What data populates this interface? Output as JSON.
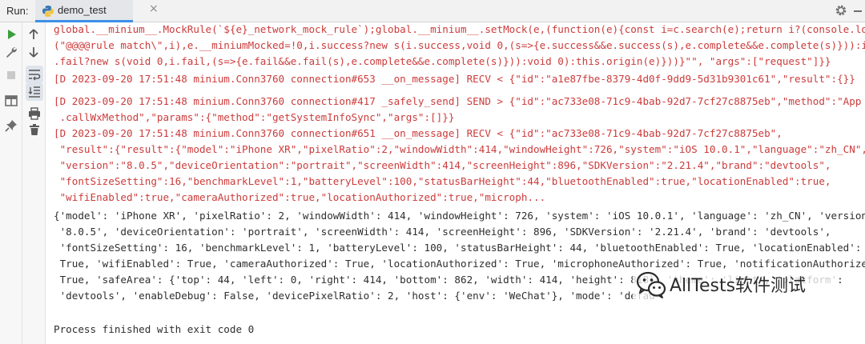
{
  "header": {
    "run_label": "Run:",
    "tab_label": "demo_test",
    "tab_close": "×"
  },
  "toolbar_left": [
    {
      "name": "run-icon"
    },
    {
      "name": "wrench-icon"
    },
    {
      "name": "stop-icon"
    },
    {
      "name": "layout-icon"
    },
    {
      "name": "pin-icon"
    }
  ],
  "toolbar_right": [
    {
      "name": "arrow-up-icon"
    },
    {
      "name": "arrow-down-icon"
    },
    {
      "name": "soft-wrap-icon"
    },
    {
      "name": "scroll-to-end-icon"
    },
    {
      "name": "print-icon"
    },
    {
      "name": "trash-icon"
    }
  ],
  "console": {
    "lines": [
      {
        "color": "red",
        "text": "global.__minium__.MockRule(`${e}_network_mock_rule`);global.__minium__.setMock(e,(function(e){const i=c.search(e);return i?(console.log"
      },
      {
        "color": "red",
        "text": "(\"@@@@rule match\\\",i),e.__miniumMocked=!0,i.success?new s(i.success,void 0,(s=>{e.success&&e.success(s),e.complete&&e.complete(s)})):i"
      },
      {
        "color": "red",
        "text": ".fail?new s(void 0,i.fail,(s=>{e.fail&&e.fail(s),e.complete&&e.complete(s)})):void 0):this.origin(e)}))}\"\", \"args\":[\"request\"]}}"
      },
      {
        "color": "red",
        "text": "[D 2023-09-20 17:51:48 minium.Conn3760 connection#653 __on_message] RECV < {\"id\":\"a1e87fbe-8379-4d0f-9dd9-5d31b9301c61\",\"result\":{}}"
      },
      {
        "color": "red",
        "text": "[D 2023-09-20 17:51:48 minium.Conn3760 connection#417 _safely_send] SEND > {\"id\":\"ac733e08-71c9-4bab-92d7-7cf27c8875eb\",\"method\":\"App"
      },
      {
        "color": "red",
        "text": " .callWxMethod\",\"params\":{\"method\":\"getSystemInfoSync\",\"args\":[]}}"
      },
      {
        "color": "red",
        "text": "[D 2023-09-20 17:51:48 minium.Conn3760 connection#651 __on_message] RECV < {\"id\":\"ac733e08-71c9-4bab-92d7-7cf27c8875eb\","
      },
      {
        "color": "red",
        "text": " \"result\":{\"result\":{\"model\":\"iPhone XR\",\"pixelRatio\":2,\"windowWidth\":414,\"windowHeight\":726,\"system\":\"iOS 10.0.1\",\"language\":\"zh_CN\","
      },
      {
        "color": "red",
        "text": " \"version\":\"8.0.5\",\"deviceOrientation\":\"portrait\",\"screenWidth\":414,\"screenHeight\":896,\"SDKVersion\":\"2.21.4\",\"brand\":\"devtools\","
      },
      {
        "color": "red",
        "text": " \"fontSizeSetting\":16,\"benchmarkLevel\":1,\"batteryLevel\":100,\"statusBarHeight\":44,\"bluetoothEnabled\":true,\"locationEnabled\":true,"
      },
      {
        "color": "red",
        "text": " \"wifiEnabled\":true,\"cameraAuthorized\":true,\"locationAuthorized\":true,\"microph..."
      },
      {
        "color": "blk",
        "text": "{'model': 'iPhone XR', 'pixelRatio': 2, 'windowWidth': 414, 'windowHeight': 726, 'system': 'iOS 10.0.1', 'language': 'zh_CN', 'version':"
      },
      {
        "color": "blk",
        "text": " '8.0.5', 'deviceOrientation': 'portrait', 'screenWidth': 414, 'screenHeight': 896, 'SDKVersion': '2.21.4', 'brand': 'devtools',"
      },
      {
        "color": "blk",
        "text": " 'fontSizeSetting': 16, 'benchmarkLevel': 1, 'batteryLevel': 100, 'statusBarHeight': 44, 'bluetoothEnabled': True, 'locationEnabled':"
      },
      {
        "color": "blk",
        "text": " True, 'wifiEnabled': True, 'cameraAuthorized': True, 'locationAuthorized': True, 'microphoneAuthorized': True, 'notificationAuthorized':"
      },
      {
        "color": "blk",
        "text": " True, 'safeArea': {'top': 44, 'left': 0, 'right': 414, 'bottom': 862, 'width': 414, 'height': 818}, 'theme': 'light', 'platform':"
      },
      {
        "color": "blk",
        "text": " 'devtools', 'enableDebug': False, 'devicePixelRatio': 2, 'host': {'env': 'WeChat'}, 'mode': 'defau"
      },
      {
        "color": "blk",
        "text": ""
      },
      {
        "color": "blk",
        "text": "Process finished with exit code 0"
      }
    ]
  },
  "watermark": {
    "text": "AllTests软件测试"
  },
  "colors": {
    "log_red": "#cc3b3b",
    "output_black": "#2e2e2e",
    "run_green": "#3a9e3f",
    "tab_underline": "#3d8fe8"
  }
}
